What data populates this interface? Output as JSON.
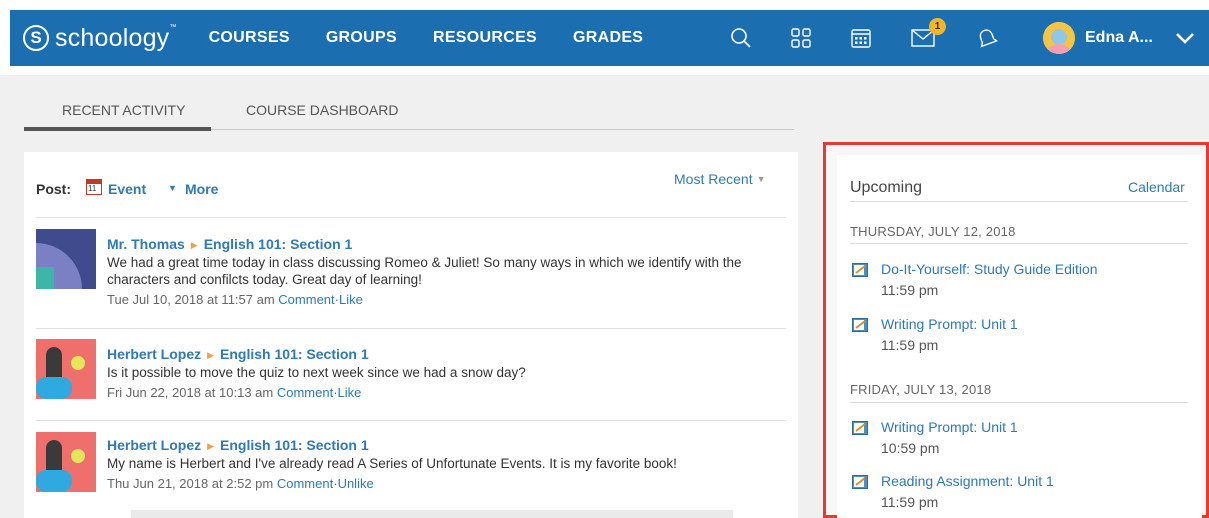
{
  "navbar": {
    "brand": "schoology",
    "links": [
      "COURSES",
      "GROUPS",
      "RESOURCES",
      "GRADES"
    ],
    "icons": [
      "search-icon",
      "apps-grid-icon",
      "calendar-icon",
      "messages-icon",
      "notifications-bell-icon"
    ],
    "message_badge": "1",
    "user_name": "Edna A...",
    "colors": {
      "bar": "#1b6fb0",
      "badge": "#f2b527"
    }
  },
  "tabs": {
    "recent_activity": "RECENT ACTIVITY",
    "course_dashboard": "COURSE DASHBOARD"
  },
  "feed": {
    "post_label": "Post:",
    "event_icon_number": "11",
    "event_label": "Event",
    "more_label": "More",
    "sort_label": "Most Recent",
    "items": [
      {
        "author": "Mr. Thomas",
        "course": "English 101: Section 1",
        "text": "We had a great time today in class discussing Romeo & Juliet! So many ways in which we identify with the characters and confilcts today. Great day of learning!",
        "timestamp": "Tue Jul 10, 2018 at 11:57 am",
        "comment": "Comment",
        "sep": "·",
        "like": "Like"
      },
      {
        "author": "Herbert Lopez",
        "course": "English 101: Section 1",
        "text": "Is it possible to move the quiz to next week since we had a snow day?",
        "timestamp": "Fri Jun 22, 2018 at 10:13 am",
        "comment": "Comment",
        "sep": "·",
        "like": "Like"
      },
      {
        "author": "Herbert Lopez",
        "course": "English 101: Section 1",
        "text": "My name is Herbert and I've already read A Series of Unfortunate Events. It is my favorite book!",
        "timestamp": "Thu Jun 21, 2018 at 2:52 pm",
        "comment": "Comment",
        "sep": "·",
        "like": "Unlike"
      }
    ]
  },
  "upcoming": {
    "title": "Upcoming",
    "calendar_link": "Calendar",
    "days": [
      {
        "date": "THURSDAY, JULY 12, 2018",
        "items": [
          {
            "name": "Do-It-Yourself: Study Guide Edition",
            "time": "11:59 pm"
          },
          {
            "name": "Writing Prompt: Unit 1",
            "time": "11:59 pm"
          }
        ]
      },
      {
        "date": "FRIDAY, JULY 13, 2018",
        "items": [
          {
            "name": "Writing Prompt: Unit 1",
            "time": "10:59 pm"
          },
          {
            "name": "Reading Assignment: Unit 1",
            "time": "11:59 pm"
          }
        ]
      }
    ]
  }
}
